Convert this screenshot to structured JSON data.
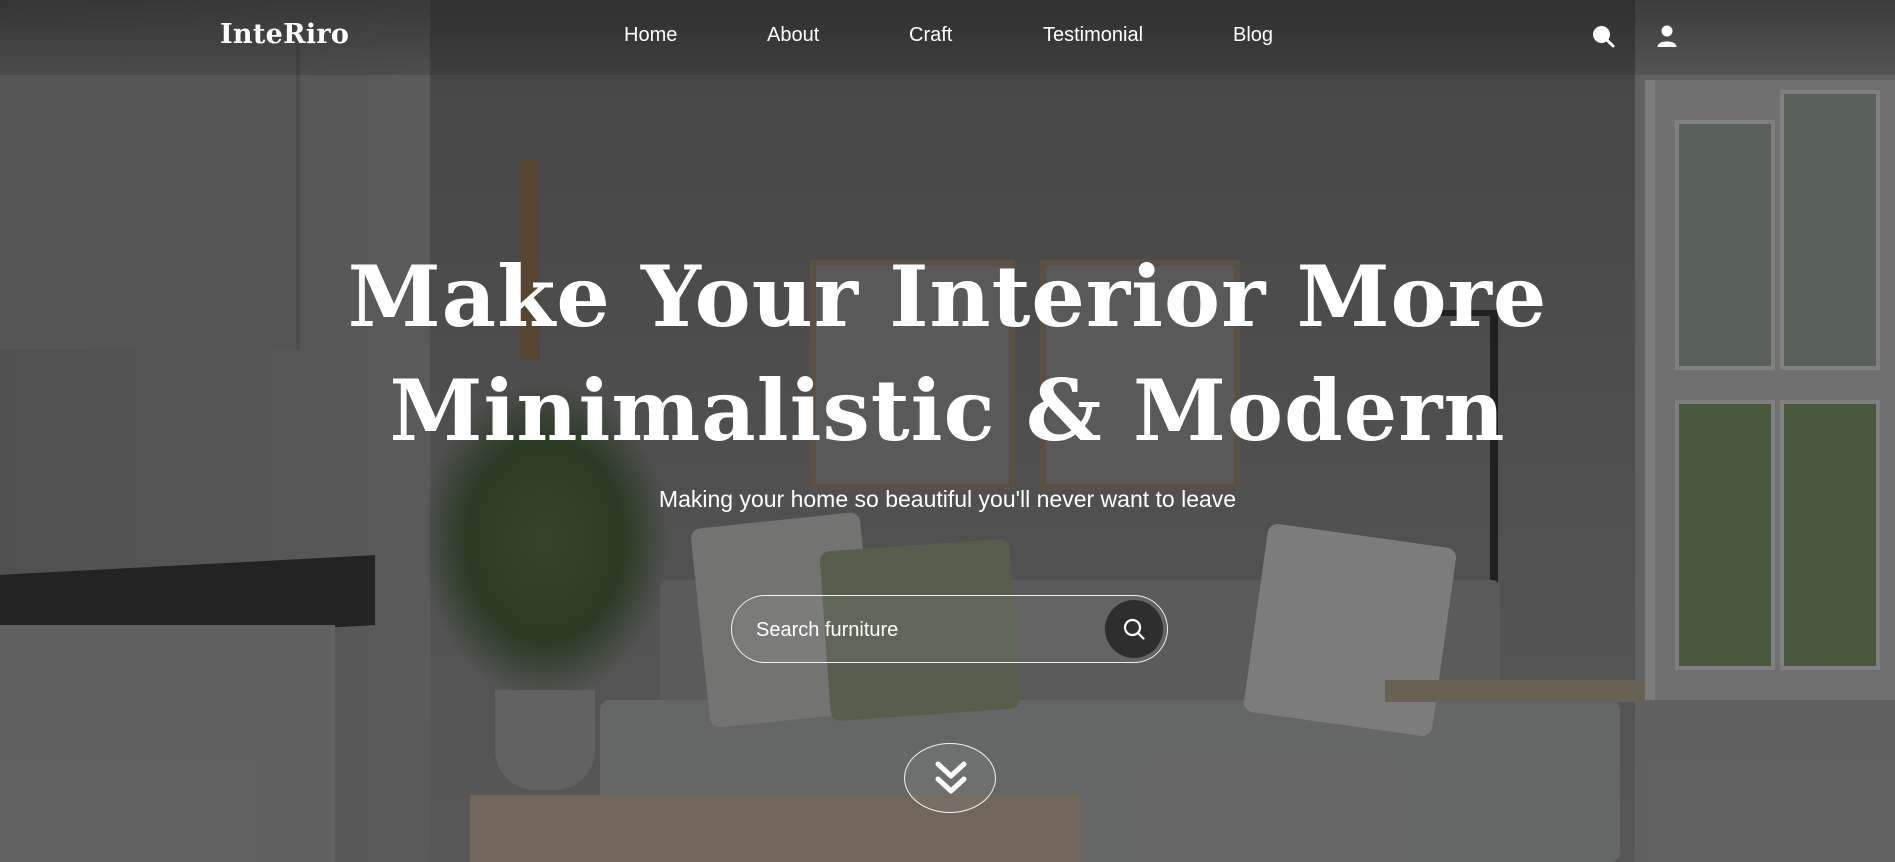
{
  "brand": {
    "name": "InteRiro"
  },
  "nav": {
    "items": [
      {
        "label": "Home"
      },
      {
        "label": "About"
      },
      {
        "label": "Craft"
      },
      {
        "label": "Testimonial"
      },
      {
        "label": "Blog"
      }
    ]
  },
  "header_icons": {
    "search": "search-icon",
    "user": "user-icon"
  },
  "hero": {
    "headline_line1": "Make Your Interior More",
    "headline_line2": "Minimalistic & Modern",
    "subheadline": "Making your home so beautiful you'll never want to leave",
    "search": {
      "placeholder": "Search furniture",
      "value": "",
      "button_icon": "search-icon"
    },
    "scroll_icon": "double-chevron-down-icon"
  },
  "colors": {
    "text": "#ffffff",
    "search_button": "#2e2e2e",
    "overlay": "#141414"
  }
}
